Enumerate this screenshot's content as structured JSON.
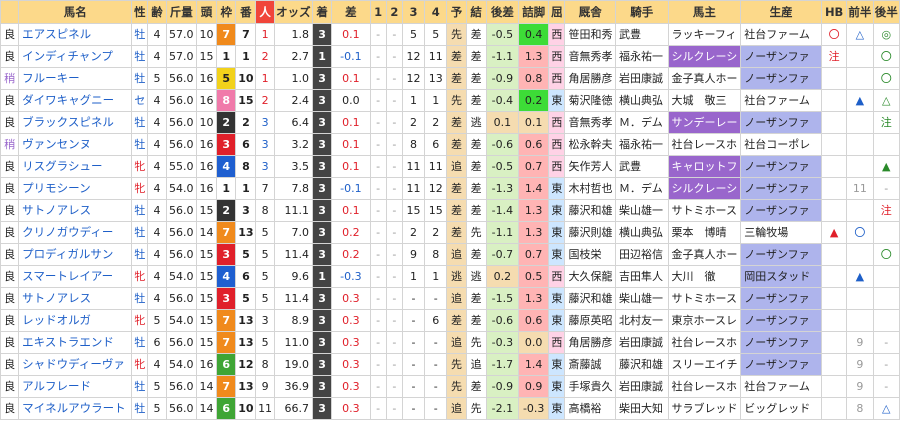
{
  "columns": [
    "",
    "馬名",
    "性",
    "齢",
    "斤量",
    "頭",
    "枠",
    "番",
    "人",
    "オッズ",
    "着",
    "差",
    "1",
    "2",
    "3",
    "4",
    "予",
    "結",
    "後差",
    "詰脚",
    "屈",
    "厩舎",
    "騎手",
    "馬主",
    "生産",
    "HB",
    "前半",
    "後半"
  ],
  "colors": {
    "header": "#fcd98a",
    "ninki_header": "#f0453a",
    "chaku": "#444444",
    "pale_green": "#d9f0c3",
    "bright_green": "#3ddc37",
    "light_red": "#ffb4b4",
    "tan": "#f5dcb0",
    "west_pink": "#ffd2e6",
    "east_blue": "#cde6ff",
    "owner_purple": "#9966cc",
    "breeder_lav": "#aeb4ec",
    "waku": {
      "1": "#ffffff",
      "2": "#333333",
      "3": "#e0202a",
      "4": "#1f5fd0",
      "5": "#f2d21b",
      "6": "#3fa535",
      "7": "#f08a1c",
      "8": "#f07aaa"
    },
    "mark_red": "#e0202a",
    "mark_blue": "#1e5fc8",
    "mark_green": "#2a8a2a",
    "mark_grey": "#999999"
  },
  "rows": [
    {
      "baba": "良",
      "name": "エアスピネル",
      "sex": "牡",
      "age": "4",
      "kin": "57.0",
      "tou": "10",
      "waku": "7",
      "ban": "7",
      "nin": "1",
      "odds": "1.8",
      "chaku": "3",
      "sa": "0.1",
      "c1": "-",
      "c2": "-",
      "c3": "5",
      "c4": "5",
      "yo": "先",
      "ke": "差",
      "go": "-0.5",
      "tsu": "0.4",
      "ku": "西",
      "kyu": "笹田和秀",
      "kis": "武豊",
      "owner": "ラッキーフィ",
      "owner_style": "plain",
      "prod": "社台ファーム",
      "prod_style": "plain",
      "hb": "〇",
      "hb_c": "red",
      "zen": "△",
      "zen_c": "blue",
      "kou": "◎",
      "kou_c": "green",
      "nin_c": "red",
      "sa_c": "red",
      "go_bg": "pale",
      "tsu_bg": "green",
      "ku_bg": "west"
    },
    {
      "baba": "良",
      "name": "インディチャンプ",
      "sex": "牡",
      "age": "4",
      "kin": "57.0",
      "tou": "15",
      "waku": "1",
      "ban": "1",
      "nin": "2",
      "odds": "2.7",
      "chaku": "1",
      "sa": "-0.1",
      "c1": "-",
      "c2": "-",
      "c3": "12",
      "c4": "11",
      "yo": "差",
      "ke": "差",
      "go": "-1.1",
      "tsu": "1.3",
      "ku": "西",
      "kyu": "音無秀孝",
      "kis": "福永祐一",
      "owner": "シルクレーシ",
      "owner_style": "purple",
      "prod": "ノーザンファ",
      "prod_style": "lav",
      "hb": "注",
      "hb_c": "red",
      "zen": "",
      "zen_c": "",
      "kou": "〇",
      "kou_c": "green",
      "nin_c": "red",
      "sa_c": "blue",
      "go_bg": "pale",
      "tsu_bg": "red",
      "ku_bg": "west"
    },
    {
      "baba": "稍",
      "name": "フルーキー",
      "sex": "牡",
      "age": "5",
      "kin": "56.0",
      "tou": "16",
      "waku": "5",
      "ban": "10",
      "nin": "1",
      "odds": "1.0",
      "chaku": "3",
      "sa": "0.1",
      "c1": "-",
      "c2": "-",
      "c3": "12",
      "c4": "13",
      "yo": "差",
      "ke": "差",
      "go": "-0.9",
      "tsu": "0.8",
      "ku": "西",
      "kyu": "角居勝彦",
      "kis": "岩田康誠",
      "owner": "金子真人ホー",
      "owner_style": "plain",
      "prod": "ノーザンファ",
      "prod_style": "lav",
      "hb": "",
      "hb_c": "",
      "zen": "",
      "zen_c": "",
      "kou": "〇",
      "kou_c": "green",
      "nin_c": "red",
      "sa_c": "red",
      "go_bg": "pale",
      "tsu_bg": "red",
      "ku_bg": "west"
    },
    {
      "baba": "良",
      "name": "ダイワキャグニー",
      "sex": "セ",
      "age": "4",
      "kin": "56.0",
      "tou": "16",
      "waku": "8",
      "ban": "15",
      "nin": "2",
      "odds": "2.4",
      "chaku": "3",
      "sa": "0.0",
      "c1": "-",
      "c2": "-",
      "c3": "1",
      "c4": "1",
      "yo": "先",
      "ke": "差",
      "go": "-0.4",
      "tsu": "0.2",
      "ku": "東",
      "kyu": "菊沢隆徳",
      "kis": "横山典弘",
      "owner": "大城　敬三",
      "owner_style": "plain",
      "prod": "社台ファーム",
      "prod_style": "plain",
      "hb": "",
      "hb_c": "",
      "zen": "▲",
      "zen_c": "blue",
      "kou": "△",
      "kou_c": "green",
      "nin_c": "red",
      "sa_c": "plain",
      "go_bg": "pale",
      "tsu_bg": "green",
      "ku_bg": "east"
    },
    {
      "baba": "良",
      "name": "ブラックスピネル",
      "sex": "牡",
      "age": "4",
      "kin": "56.0",
      "tou": "10",
      "waku": "2",
      "ban": "2",
      "nin": "3",
      "odds": "6.4",
      "chaku": "3",
      "sa": "0.1",
      "c1": "-",
      "c2": "-",
      "c3": "2",
      "c4": "2",
      "yo": "差",
      "ke": "逃",
      "go": "0.1",
      "tsu": "0.1",
      "ku": "西",
      "kyu": "音無秀孝",
      "kis": "Ｍ．デム",
      "owner": "サンデーレー",
      "owner_style": "purple",
      "prod": "ノーザンファ",
      "prod_style": "lav",
      "hb": "",
      "hb_c": "",
      "zen": "",
      "zen_c": "",
      "kou": "注",
      "kou_c": "green",
      "nin_c": "blue",
      "sa_c": "red",
      "go_bg": "tan",
      "tsu_bg": "tan",
      "ku_bg": "west"
    },
    {
      "baba": "稍",
      "name": "ヴァンセンヌ",
      "sex": "牡",
      "age": "4",
      "kin": "56.0",
      "tou": "16",
      "waku": "3",
      "ban": "6",
      "nin": "3",
      "odds": "3.2",
      "chaku": "3",
      "sa": "0.1",
      "c1": "-",
      "c2": "-",
      "c3": "8",
      "c4": "6",
      "yo": "差",
      "ke": "差",
      "go": "-0.6",
      "tsu": "0.6",
      "ku": "西",
      "kyu": "松永幹夫",
      "kis": "福永祐一",
      "owner": "社台レースホ",
      "owner_style": "plain",
      "prod": "社台コーポレ",
      "prod_style": "plain",
      "hb": "",
      "hb_c": "",
      "zen": "",
      "zen_c": "",
      "kou": "",
      "kou_c": "",
      "nin_c": "blue",
      "sa_c": "red",
      "go_bg": "pale",
      "tsu_bg": "red",
      "ku_bg": "west"
    },
    {
      "baba": "良",
      "name": "リスグラシュー",
      "sex": "牝",
      "age": "4",
      "kin": "55.0",
      "tou": "16",
      "waku": "4",
      "ban": "8",
      "nin": "3",
      "odds": "3.5",
      "chaku": "3",
      "sa": "0.1",
      "c1": "-",
      "c2": "-",
      "c3": "11",
      "c4": "11",
      "yo": "追",
      "ke": "差",
      "go": "-0.5",
      "tsu": "0.7",
      "ku": "西",
      "kyu": "矢作芳人",
      "kis": "武豊",
      "owner": "キャロットフ",
      "owner_style": "purple",
      "prod": "ノーザンファ",
      "prod_style": "lav",
      "hb": "",
      "hb_c": "",
      "zen": "",
      "zen_c": "",
      "kou": "▲",
      "kou_c": "green",
      "nin_c": "blue",
      "sa_c": "red",
      "go_bg": "pale",
      "tsu_bg": "red",
      "ku_bg": "west"
    },
    {
      "baba": "良",
      "name": "プリモシーン",
      "sex": "牝",
      "age": "4",
      "kin": "54.0",
      "tou": "16",
      "waku": "1",
      "ban": "1",
      "nin": "7",
      "odds": "7.8",
      "chaku": "3",
      "sa": "-0.1",
      "c1": "-",
      "c2": "-",
      "c3": "11",
      "c4": "12",
      "yo": "差",
      "ke": "差",
      "go": "-1.3",
      "tsu": "1.4",
      "ku": "東",
      "kyu": "木村哲也",
      "kis": "Ｍ．デム",
      "owner": "シルクレーシ",
      "owner_style": "purple",
      "prod": "ノーザンファ",
      "prod_style": "lav",
      "hb": "",
      "hb_c": "",
      "zen": "11",
      "zen_c": "grey",
      "kou": "-",
      "kou_c": "grey",
      "nin_c": "plain",
      "sa_c": "blue",
      "go_bg": "pale",
      "tsu_bg": "red",
      "ku_bg": "east"
    },
    {
      "baba": "良",
      "name": "サトノアレス",
      "sex": "牡",
      "age": "4",
      "kin": "56.0",
      "tou": "15",
      "waku": "2",
      "ban": "3",
      "nin": "8",
      "odds": "11.1",
      "chaku": "3",
      "sa": "0.1",
      "c1": "-",
      "c2": "-",
      "c3": "15",
      "c4": "15",
      "yo": "差",
      "ke": "差",
      "go": "-1.4",
      "tsu": "1.3",
      "ku": "東",
      "kyu": "藤沢和雄",
      "kis": "柴山雄一",
      "owner": "サトミホース",
      "owner_style": "plain",
      "prod": "ノーザンファ",
      "prod_style": "lav",
      "hb": "",
      "hb_c": "",
      "zen": "",
      "zen_c": "",
      "kou": "注",
      "kou_c": "red",
      "nin_c": "plain",
      "sa_c": "red",
      "go_bg": "pale",
      "tsu_bg": "red",
      "ku_bg": "east"
    },
    {
      "baba": "良",
      "name": "クリノガウディー",
      "sex": "牡",
      "age": "4",
      "kin": "56.0",
      "tou": "14",
      "waku": "7",
      "ban": "13",
      "nin": "5",
      "odds": "7.0",
      "chaku": "3",
      "sa": "0.2",
      "c1": "-",
      "c2": "-",
      "c3": "2",
      "c4": "2",
      "yo": "差",
      "ke": "先",
      "go": "-1.1",
      "tsu": "1.3",
      "ku": "東",
      "kyu": "藤沢則雄",
      "kis": "横山典弘",
      "owner": "栗本　博晴",
      "owner_style": "plain",
      "prod": "三輪牧場",
      "prod_style": "plain",
      "hb": "▲",
      "hb_c": "red",
      "zen": "〇",
      "zen_c": "blue",
      "kou": "",
      "kou_c": "",
      "nin_c": "plain",
      "sa_c": "red",
      "go_bg": "pale",
      "tsu_bg": "red",
      "ku_bg": "east"
    },
    {
      "baba": "良",
      "name": "プロディガルサン",
      "sex": "牡",
      "age": "4",
      "kin": "56.0",
      "tou": "15",
      "waku": "3",
      "ban": "5",
      "nin": "5",
      "odds": "11.4",
      "chaku": "3",
      "sa": "0.2",
      "c1": "-",
      "c2": "-",
      "c3": "9",
      "c4": "8",
      "yo": "追",
      "ke": "差",
      "go": "-0.7",
      "tsu": "0.7",
      "ku": "東",
      "kyu": "国枝栄",
      "kis": "田辺裕信",
      "owner": "金子真人ホー",
      "owner_style": "plain",
      "prod": "ノーザンファ",
      "prod_style": "lav",
      "hb": "",
      "hb_c": "",
      "zen": "",
      "zen_c": "",
      "kou": "〇",
      "kou_c": "green",
      "nin_c": "plain",
      "sa_c": "red",
      "go_bg": "pale",
      "tsu_bg": "red",
      "ku_bg": "east"
    },
    {
      "baba": "良",
      "name": "スマートレイアー",
      "sex": "牝",
      "age": "4",
      "kin": "54.0",
      "tou": "15",
      "waku": "4",
      "ban": "6",
      "nin": "5",
      "odds": "9.6",
      "chaku": "1",
      "sa": "-0.3",
      "c1": "-",
      "c2": "-",
      "c3": "1",
      "c4": "1",
      "yo": "逃",
      "ke": "逃",
      "go": "0.2",
      "tsu": "0.5",
      "ku": "西",
      "kyu": "大久保龍",
      "kis": "吉田隼人",
      "owner": "大川　徹",
      "owner_style": "plain",
      "prod": "岡田スタッド",
      "prod_style": "lav",
      "hb": "",
      "hb_c": "",
      "zen": "▲",
      "zen_c": "blue",
      "kou": "",
      "kou_c": "",
      "nin_c": "plain",
      "sa_c": "blue",
      "go_bg": "tan",
      "tsu_bg": "red",
      "ku_bg": "west"
    },
    {
      "baba": "良",
      "name": "サトノアレス",
      "sex": "牡",
      "age": "4",
      "kin": "56.0",
      "tou": "15",
      "waku": "3",
      "ban": "5",
      "nin": "5",
      "odds": "11.4",
      "chaku": "3",
      "sa": "0.3",
      "c1": "-",
      "c2": "-",
      "c3": "-",
      "c4": "-",
      "yo": "追",
      "ke": "差",
      "go": "-1.5",
      "tsu": "1.3",
      "ku": "東",
      "kyu": "藤沢和雄",
      "kis": "柴山雄一",
      "owner": "サトミホース",
      "owner_style": "plain",
      "prod": "ノーザンファ",
      "prod_style": "lav",
      "hb": "",
      "hb_c": "",
      "zen": "",
      "zen_c": "",
      "kou": "",
      "kou_c": "",
      "nin_c": "plain",
      "sa_c": "red",
      "go_bg": "pale",
      "tsu_bg": "red",
      "ku_bg": "east"
    },
    {
      "baba": "良",
      "name": "レッドオルガ",
      "sex": "牝",
      "age": "5",
      "kin": "54.0",
      "tou": "15",
      "waku": "7",
      "ban": "13",
      "nin": "3",
      "odds": "8.9",
      "chaku": "3",
      "sa": "0.3",
      "c1": "-",
      "c2": "-",
      "c3": "-",
      "c4": "6",
      "yo": "差",
      "ke": "差",
      "go": "-0.6",
      "tsu": "0.6",
      "ku": "東",
      "kyu": "藤原英昭",
      "kis": "北村友一",
      "owner": "東京ホースレ",
      "owner_style": "plain",
      "prod": "ノーザンファ",
      "prod_style": "lav",
      "hb": "",
      "hb_c": "",
      "zen": "",
      "zen_c": "",
      "kou": "",
      "kou_c": "",
      "nin_c": "plain",
      "sa_c": "red",
      "go_bg": "pale",
      "tsu_bg": "red",
      "ku_bg": "east"
    },
    {
      "baba": "良",
      "name": "エキストラエンド",
      "sex": "牡",
      "age": "6",
      "kin": "56.0",
      "tou": "15",
      "waku": "7",
      "ban": "13",
      "nin": "5",
      "odds": "11.0",
      "chaku": "3",
      "sa": "0.3",
      "c1": "-",
      "c2": "-",
      "c3": "-",
      "c4": "-",
      "yo": "追",
      "ke": "先",
      "go": "-0.3",
      "tsu": "0.0",
      "ku": "西",
      "kyu": "角居勝彦",
      "kis": "岩田康誠",
      "owner": "社台レースホ",
      "owner_style": "plain",
      "prod": "ノーザンファ",
      "prod_style": "lav",
      "hb": "",
      "hb_c": "",
      "zen": "9",
      "zen_c": "grey",
      "kou": "-",
      "kou_c": "grey",
      "nin_c": "plain",
      "sa_c": "red",
      "go_bg": "pale",
      "tsu_bg": "tan",
      "ku_bg": "west"
    },
    {
      "baba": "良",
      "name": "シャドウディーヴァ",
      "sex": "牝",
      "age": "4",
      "kin": "54.0",
      "tou": "16",
      "waku": "6",
      "ban": "12",
      "nin": "8",
      "odds": "19.0",
      "chaku": "3",
      "sa": "0.3",
      "c1": "-",
      "c2": "-",
      "c3": "-",
      "c4": "-",
      "yo": "先",
      "ke": "追",
      "go": "-1.7",
      "tsu": "1.4",
      "ku": "東",
      "kyu": "斎藤誠",
      "kis": "藤沢和雄",
      "owner": "スリーエイチ",
      "owner_style": "plain",
      "prod": "ノーザンファ",
      "prod_style": "lav",
      "hb": "",
      "hb_c": "",
      "zen": "9",
      "zen_c": "grey",
      "kou": "-",
      "kou_c": "grey",
      "nin_c": "plain",
      "sa_c": "red",
      "go_bg": "pale",
      "tsu_bg": "red",
      "ku_bg": "east"
    },
    {
      "baba": "良",
      "name": "アルフレード",
      "sex": "牡",
      "age": "5",
      "kin": "56.0",
      "tou": "14",
      "waku": "7",
      "ban": "13",
      "nin": "9",
      "odds": "36.9",
      "chaku": "3",
      "sa": "0.3",
      "c1": "-",
      "c2": "-",
      "c3": "-",
      "c4": "-",
      "yo": "先",
      "ke": "差",
      "go": "-0.9",
      "tsu": "0.9",
      "ku": "東",
      "kyu": "手塚貴久",
      "kis": "岩田康誠",
      "owner": "社台レースホ",
      "owner_style": "plain",
      "prod": "社台ファーム",
      "prod_style": "plain",
      "hb": "",
      "hb_c": "",
      "zen": "9",
      "zen_c": "grey",
      "kou": "-",
      "kou_c": "grey",
      "nin_c": "plain",
      "sa_c": "red",
      "go_bg": "pale",
      "tsu_bg": "red",
      "ku_bg": "east"
    },
    {
      "baba": "良",
      "name": "マイネルアウラート",
      "sex": "牡",
      "age": "5",
      "kin": "56.0",
      "tou": "14",
      "waku": "6",
      "ban": "10",
      "nin": "11",
      "odds": "66.7",
      "chaku": "3",
      "sa": "0.3",
      "c1": "-",
      "c2": "-",
      "c3": "-",
      "c4": "-",
      "yo": "追",
      "ke": "先",
      "go": "-2.1",
      "tsu": "-0.3",
      "ku": "東",
      "kyu": "高橋裕",
      "kis": "柴田大知",
      "owner": "サラブレッド",
      "owner_style": "plain",
      "prod": "ビッグレッド",
      "prod_style": "plain",
      "hb": "",
      "hb_c": "",
      "zen": "8",
      "zen_c": "grey",
      "kou": "△",
      "kou_c": "blue",
      "nin_c": "plain",
      "sa_c": "red",
      "go_bg": "pale",
      "tsu_bg": "tan",
      "ku_bg": "east"
    }
  ]
}
